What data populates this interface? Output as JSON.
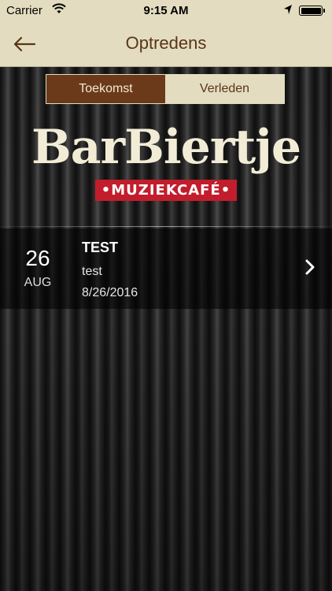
{
  "status_bar": {
    "carrier": "Carrier",
    "time": "9:15 AM"
  },
  "nav": {
    "title": "Optredens"
  },
  "segments": {
    "active_label": "Toekomst",
    "inactive_label": "Verleden"
  },
  "logo": {
    "word": "BarBiertje",
    "badge": "•MUZIEKCAFÉ•"
  },
  "events": [
    {
      "day": "26",
      "month": "AUG",
      "name": "TEST",
      "description": "test",
      "date": "8/26/2016"
    }
  ],
  "colors": {
    "nav_background": "#e3dcc0",
    "nav_title": "#5a3517",
    "segment_active": "#6b3a1a",
    "badge_red": "#c21d2c"
  }
}
